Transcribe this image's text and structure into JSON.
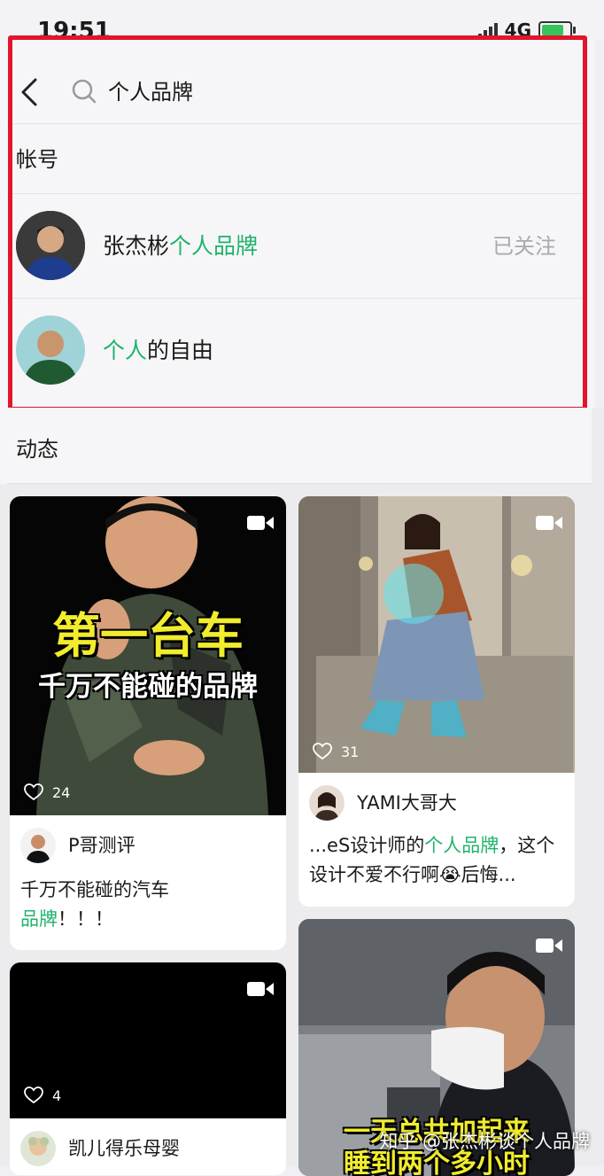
{
  "status_bar": {
    "time": "19:51",
    "network": "4G"
  },
  "search": {
    "query": "个人品牌"
  },
  "accounts_section": {
    "title": "帐号",
    "items": [
      {
        "name_prefix": "张杰彬",
        "name_highlight": "个人品牌",
        "name_suffix": "",
        "follow_status": "已关注"
      },
      {
        "name_prefix": "",
        "name_highlight": "个人",
        "name_suffix": "的自由",
        "follow_status": ""
      }
    ]
  },
  "moments_section": {
    "title": "动态"
  },
  "feed": [
    {
      "thumb_text_main": "第一台车",
      "thumb_text_sub": "千万不能碰的品牌",
      "likes": "24",
      "author": "P哥测评",
      "desc_plain": "千万不能碰的汽车",
      "desc_highlight": "品牌",
      "desc_tail": "！！！"
    },
    {
      "likes": "31",
      "author": "YAMI大哥大",
      "desc_plain": "...eS设计师的",
      "desc_highlight": "个人品牌",
      "desc_tail": "，这个设计不爱不行啊😭后悔..."
    },
    {
      "likes": "4",
      "author": "凯儿得乐母婴"
    },
    {
      "thumb_text_main": "一天总共加起来",
      "thumb_text_sub": "睡到两个多小时"
    }
  ],
  "watermark": "知乎 @张杰彬谈个人品牌",
  "colors": {
    "highlight": "#1fb36b",
    "annotation": "#e2152b"
  },
  "icons": [
    "back-chevron-icon",
    "search-icon",
    "video-camera-icon",
    "heart-icon"
  ]
}
